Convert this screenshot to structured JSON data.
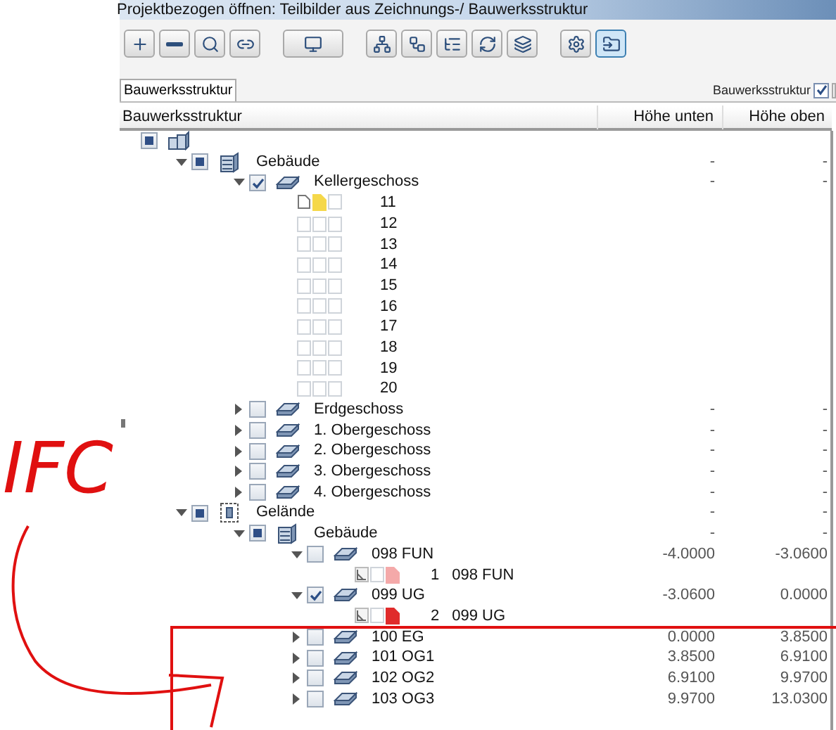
{
  "window": {
    "title": "Projektbezogen öffnen: Teilbilder aus Zeichnungs-/ Bauwerksstruktur"
  },
  "toolbar": [
    [
      {
        "pressed": false
      },
      {
        "pressed": false
      },
      {
        "pressed": false
      },
      {
        "pressed": false
      }
    ],
    [
      {
        "pressed": false
      }
    ],
    [
      {
        "pressed": false
      },
      {
        "pressed": false
      },
      {
        "pressed": false
      },
      {
        "pressed": false
      },
      {
        "pressed": false
      }
    ],
    [
      {
        "pressed": false
      },
      {
        "pressed": true
      }
    ]
  ],
  "tabs": [
    {
      "label": "Bauwerksstruktur",
      "selected": true
    }
  ],
  "view_toggle": {
    "label": "Bauwerksstruktur",
    "checked": true
  },
  "table": {
    "columns": [
      "Bauwerksstruktur",
      "Höhe unten",
      "Höhe oben"
    ],
    "tree": [
      {
        "kind": "complex",
        "checked": true,
        "partial": true,
        "children": [
          {
            "kind": "building",
            "label": "Gebäude",
            "expanded": true,
            "checked": true,
            "partial": true,
            "low": "-",
            "high": "-",
            "children": [
              {
                "kind": "floor",
                "label": "Kellergeschoss",
                "expanded": true,
                "checked": true,
                "partial": false,
                "low": "-",
                "high": "-",
                "children": [
                  {
                    "kind": "sheet",
                    "label": "11",
                    "slots": [
                      {
                        "kind": "page"
                      },
                      {
                        "kind": "note",
                        "color": "#f5d84a"
                      },
                      {
                        "kind": "empty"
                      }
                    ]
                  },
                  {
                    "kind": "sheet",
                    "label": "12",
                    "slots": [
                      {
                        "kind": "empty"
                      },
                      {
                        "kind": "empty"
                      },
                      {
                        "kind": "empty"
                      }
                    ]
                  },
                  {
                    "kind": "sheet",
                    "label": "13",
                    "slots": [
                      {
                        "kind": "empty"
                      },
                      {
                        "kind": "empty"
                      },
                      {
                        "kind": "empty"
                      }
                    ]
                  },
                  {
                    "kind": "sheet",
                    "label": "14",
                    "slots": [
                      {
                        "kind": "empty"
                      },
                      {
                        "kind": "empty"
                      },
                      {
                        "kind": "empty"
                      }
                    ]
                  },
                  {
                    "kind": "sheet",
                    "label": "15",
                    "slots": [
                      {
                        "kind": "empty"
                      },
                      {
                        "kind": "empty"
                      },
                      {
                        "kind": "empty"
                      }
                    ]
                  },
                  {
                    "kind": "sheet",
                    "label": "16",
                    "slots": [
                      {
                        "kind": "empty"
                      },
                      {
                        "kind": "empty"
                      },
                      {
                        "kind": "empty"
                      }
                    ]
                  },
                  {
                    "kind": "sheet",
                    "label": "17",
                    "slots": [
                      {
                        "kind": "empty"
                      },
                      {
                        "kind": "empty"
                      },
                      {
                        "kind": "empty"
                      }
                    ]
                  },
                  {
                    "kind": "sheet",
                    "label": "18",
                    "slots": [
                      {
                        "kind": "empty"
                      },
                      {
                        "kind": "empty"
                      },
                      {
                        "kind": "empty"
                      }
                    ]
                  },
                  {
                    "kind": "sheet",
                    "label": "19",
                    "slots": [
                      {
                        "kind": "empty"
                      },
                      {
                        "kind": "empty"
                      },
                      {
                        "kind": "empty"
                      }
                    ]
                  },
                  {
                    "kind": "sheet",
                    "label": "20",
                    "slots": [
                      {
                        "kind": "empty"
                      },
                      {
                        "kind": "empty"
                      },
                      {
                        "kind": "empty"
                      }
                    ]
                  }
                ]
              },
              {
                "kind": "floor",
                "label": "Erdgeschoss",
                "expanded": false,
                "checked": false,
                "partial": false,
                "low": "-",
                "high": "-"
              },
              {
                "kind": "floor",
                "label": "1. Obergeschoss",
                "expanded": false,
                "checked": false,
                "partial": false,
                "low": "-",
                "high": "-"
              },
              {
                "kind": "floor",
                "label": "2. Obergeschoss",
                "expanded": false,
                "checked": false,
                "partial": false,
                "low": "-",
                "high": "-"
              },
              {
                "kind": "floor",
                "label": "3. Obergeschoss",
                "expanded": false,
                "checked": false,
                "partial": false,
                "low": "-",
                "high": "-"
              },
              {
                "kind": "floor",
                "label": "4. Obergeschoss",
                "expanded": false,
                "checked": false,
                "partial": false,
                "low": "-",
                "high": "-"
              }
            ]
          },
          {
            "kind": "site",
            "label": "Gelände",
            "expanded": true,
            "checked": true,
            "partial": true,
            "low": "-",
            "high": "-",
            "children": [
              {
                "kind": "building",
                "label": "Gebäude",
                "expanded": true,
                "checked": true,
                "partial": true,
                "low": "-",
                "high": "-",
                "children": [
                  {
                    "kind": "floor",
                    "label": "098 FUN",
                    "expanded": true,
                    "checked": false,
                    "partial": false,
                    "low": "-4.0000",
                    "high": "-3.0600",
                    "children": [
                      {
                        "kind": "sheet",
                        "number": "1",
                        "label": "098 FUN",
                        "slots": [
                          {
                            "kind": "plan"
                          },
                          {
                            "kind": "empty"
                          },
                          {
                            "kind": "note",
                            "color": "#f4a9a9"
                          }
                        ]
                      }
                    ]
                  },
                  {
                    "kind": "floor",
                    "label": "099 UG",
                    "expanded": true,
                    "checked": true,
                    "partial": false,
                    "low": "-3.0600",
                    "high": "0.0000",
                    "children": [
                      {
                        "kind": "sheet",
                        "number": "2",
                        "label": "099 UG",
                        "slots": [
                          {
                            "kind": "plan"
                          },
                          {
                            "kind": "empty"
                          },
                          {
                            "kind": "note",
                            "color": "#e02b2b"
                          }
                        ]
                      }
                    ]
                  },
                  {
                    "kind": "floor",
                    "label": "100 EG",
                    "expanded": false,
                    "checked": false,
                    "partial": false,
                    "low": "0.0000",
                    "high": "3.8500"
                  },
                  {
                    "kind": "floor",
                    "label": "101 OG1",
                    "expanded": false,
                    "checked": false,
                    "partial": false,
                    "low": "3.8500",
                    "high": "6.9100"
                  },
                  {
                    "kind": "floor",
                    "label": "102 OG2",
                    "expanded": false,
                    "checked": false,
                    "partial": false,
                    "low": "6.9100",
                    "high": "9.9700"
                  },
                  {
                    "kind": "floor",
                    "label": "103 OG3",
                    "expanded": false,
                    "checked": false,
                    "partial": false,
                    "low": "9.9700",
                    "high": "13.0300"
                  }
                ]
              }
            ]
          }
        ]
      }
    ]
  },
  "annotation": {
    "text": "IFC"
  }
}
